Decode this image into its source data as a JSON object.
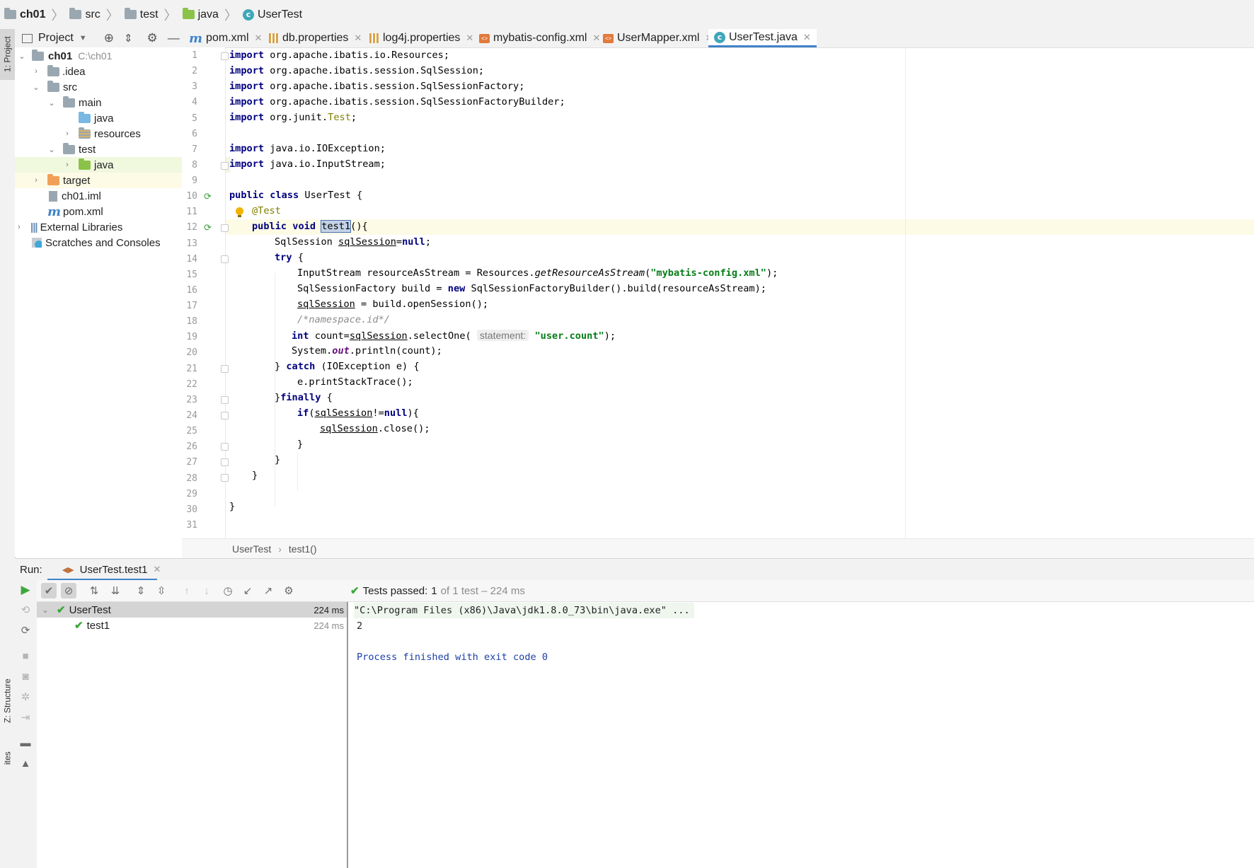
{
  "breadcrumb": {
    "items": [
      "ch01",
      "src",
      "test",
      "java",
      "UserTest"
    ]
  },
  "stripe": {
    "project_tab": "1: Project",
    "structure_tab": "Z: Structure",
    "favorites_tab": "ites"
  },
  "project_panel": {
    "title": "Project",
    "tree": [
      {
        "label": "ch01",
        "hint": "C:\\ch01"
      },
      {
        "label": ".idea"
      },
      {
        "label": "src"
      },
      {
        "label": "main"
      },
      {
        "label": "java"
      },
      {
        "label": "resources"
      },
      {
        "label": "test"
      },
      {
        "label": "java"
      },
      {
        "label": "target"
      },
      {
        "label": "ch01.iml"
      },
      {
        "label": "pom.xml"
      },
      {
        "label": "External Libraries"
      },
      {
        "label": "Scratches and Consoles"
      }
    ]
  },
  "tabs": [
    {
      "label": "pom.xml",
      "icon": "maven-icon"
    },
    {
      "label": "db.properties",
      "icon": "properties-icon"
    },
    {
      "label": "log4j.properties",
      "icon": "properties-icon"
    },
    {
      "label": "mybatis-config.xml",
      "icon": "xml-icon"
    },
    {
      "label": "UserMapper.xml",
      "icon": "xml-icon"
    },
    {
      "label": "UserTest.java",
      "icon": "class-icon",
      "active": true
    }
  ],
  "editor": {
    "line_numbers": [
      "1",
      "2",
      "3",
      "4",
      "5",
      "6",
      "7",
      "8",
      "9",
      "10",
      "11",
      "12",
      "13",
      "14",
      "15",
      "16",
      "17",
      "18",
      "19",
      "20",
      "21",
      "22",
      "23",
      "24",
      "25",
      "26",
      "27",
      "28",
      "29",
      "30",
      "31"
    ],
    "code": {
      "l1_kw": "import",
      "l1": " org.apache.ibatis.io.Resources;",
      "l2_kw": "import",
      "l2": " org.apache.ibatis.session.SqlSession;",
      "l3_kw": "import",
      "l3": " org.apache.ibatis.session.SqlSessionFactory;",
      "l4_kw": "import",
      "l4": " org.apache.ibatis.session.SqlSessionFactoryBuilder;",
      "l5_kw": "import",
      "l5a": " org.junit.",
      "l5b": "Test",
      "l5c": ";",
      "l7_kw": "import",
      "l7": " java.io.IOException;",
      "l8_kw": "import",
      "l8": " java.io.InputStream;",
      "l10_kw": "public class",
      "l10": " UserTest {",
      "l11": "@Test",
      "l12_kw": "public void",
      "l12_name": "test1",
      "l12": "(){",
      "l13a": "SqlSession ",
      "l13b": "sqlSession",
      "l13c": "=",
      "l13d": "null",
      "l13e": ";",
      "l14_kw": "try",
      "l14": " {",
      "l15a": "InputStream resourceAsStream = Resources.",
      "l15b": "getResourceAsStream",
      "l15c": "(",
      "l15d": "\"mybatis-config.xml\"",
      "l15e": ");",
      "l16a": "SqlSessionFactory build = ",
      "l16b": "new",
      "l16c": " SqlSessionFactoryBuilder().build(resourceAsStream);",
      "l17a": "sqlSession",
      "l17b": " = build.openSession();",
      "l18": "/*namespace.id*/",
      "l19a": "int",
      "l19b": " count=",
      "l19c": "sqlSession",
      "l19d": ".selectOne( ",
      "l19_hint": "statement:",
      "l19e": " ",
      "l19f": "\"user.count\"",
      "l19g": ");",
      "l20a": "System.",
      "l20b": "out",
      "l20c": ".println(count);",
      "l21a": "} ",
      "l21b": "catch",
      "l21c": " (IOException e) {",
      "l22": "e.printStackTrace();",
      "l23a": "}",
      "l23b": "finally",
      "l23c": " {",
      "l24a": "if",
      "l24b": "(",
      "l24c": "sqlSession",
      "l24d": "!=",
      "l24e": "null",
      "l24f": "){",
      "l25a": "sqlSession",
      "l25b": ".close();",
      "l26": "}",
      "l27": "}",
      "l28": "}",
      "l30": "}"
    },
    "breadcrumb": [
      "UserTest",
      "test1()"
    ]
  },
  "run_panel": {
    "label": "Run:",
    "tab": "UserTest.test1",
    "status_prefix": "Tests passed:",
    "status_count": "1",
    "status_suffix": "of 1 test – 224 ms",
    "tests": [
      {
        "name": "UserTest",
        "time": "224 ms"
      },
      {
        "name": "test1",
        "time": "224 ms"
      }
    ],
    "console": [
      "\"C:\\Program Files (x86)\\Java\\jdk1.8.0_73\\bin\\java.exe\" ...",
      "2",
      "Process finished with exit code 0"
    ]
  },
  "colors": {
    "keyword": "#000080",
    "string": "#067d17",
    "annotation": "#808000",
    "passed": "#3ba83b",
    "console_info": "#1b3fa8"
  }
}
